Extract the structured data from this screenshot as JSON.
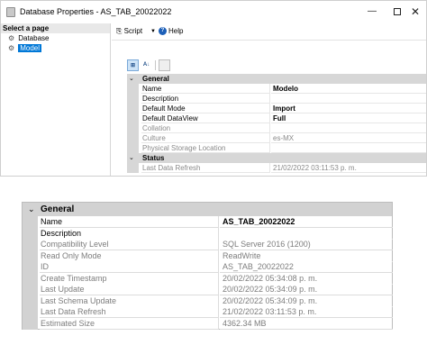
{
  "window": {
    "title": "Database Properties - AS_TAB_20022022",
    "minimize_glyph": "—",
    "close_glyph": "✕"
  },
  "left_pane": {
    "header": "Select a page",
    "items": [
      {
        "label": "Database",
        "icon": "wrench-icon",
        "selected": false
      },
      {
        "label": "Model",
        "icon": "wrench-icon",
        "selected": true
      }
    ]
  },
  "toolbar": {
    "script_label": "Script",
    "dropdown_glyph": "▼",
    "help_label": "Help"
  },
  "property_grid": {
    "categorized_glyph": "⊞",
    "alphabetical_glyph": "A↓",
    "categories": [
      {
        "name": "General",
        "chevron": "⌄",
        "rows": [
          {
            "name": "Name",
            "value": "Modelo",
            "bold": true,
            "muted": false
          },
          {
            "name": "Description",
            "value": "",
            "bold": false,
            "muted": false
          },
          {
            "name": "Default Mode",
            "value": "Import",
            "bold": true,
            "muted": false
          },
          {
            "name": "Default DataView",
            "value": "Full",
            "bold": true,
            "muted": false
          },
          {
            "name": "Collation",
            "value": "",
            "bold": false,
            "muted": true
          },
          {
            "name": "Culture",
            "value": "es-MX",
            "bold": false,
            "muted": true
          },
          {
            "name": "Physical Storage Location",
            "value": "",
            "bold": false,
            "muted": true
          }
        ]
      },
      {
        "name": "Status",
        "chevron": "⌄",
        "rows": [
          {
            "name": "Last Data Refresh",
            "value": "21/02/2022 03:11:53 p. m.",
            "bold": false,
            "muted": true
          }
        ]
      }
    ]
  },
  "database_grid": {
    "category": "General",
    "chevron": "⌄",
    "rows": [
      {
        "name": "Name",
        "value": "AS_TAB_20022022",
        "bold": true,
        "muted": false
      },
      {
        "name": "Description",
        "value": "",
        "bold": false,
        "muted": false
      },
      {
        "name": "Compatibility Level",
        "value": "SQL Server 2016 (1200)",
        "bold": false,
        "muted": true
      },
      {
        "name": "Read Only Mode",
        "value": "ReadWrite",
        "bold": false,
        "muted": true
      },
      {
        "name": "ID",
        "value": "AS_TAB_20022022",
        "bold": false,
        "muted": true
      },
      {
        "name": "Create Timestamp",
        "value": "20/02/2022 05:34:08 p. m.",
        "bold": false,
        "muted": true
      },
      {
        "name": "Last Update",
        "value": "20/02/2022 05:34:09 p. m.",
        "bold": false,
        "muted": true
      },
      {
        "name": "Last Schema Update",
        "value": "20/02/2022 05:34:09 p. m.",
        "bold": false,
        "muted": true
      },
      {
        "name": "Last Data Refresh",
        "value": "21/02/2022 03:11:53 p. m.",
        "bold": false,
        "muted": true
      },
      {
        "name": "Estimated Size",
        "value": "4362.34 MB",
        "bold": false,
        "muted": true
      }
    ]
  },
  "colors": {
    "selection": "#0078d7",
    "category_bg": "#d7d7d7",
    "muted_text": "#8a8a8a"
  }
}
